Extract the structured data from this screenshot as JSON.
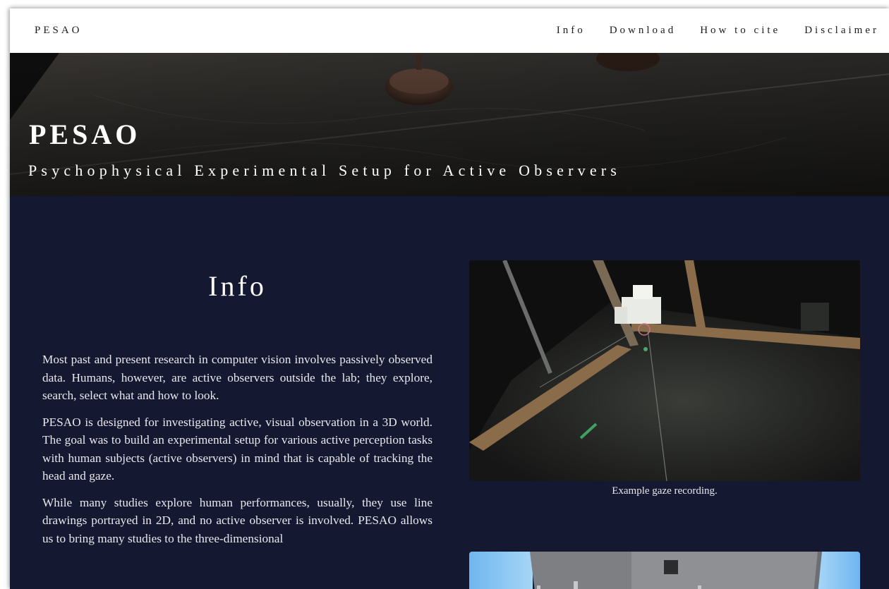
{
  "nav": {
    "brand": "PESAO",
    "links": [
      "Info",
      "Download",
      "How to cite",
      "Disclaimer"
    ]
  },
  "hero": {
    "title": "PESAO",
    "subtitle": "Psychophysical Experimental Setup for Active Observers"
  },
  "info": {
    "heading": "Info",
    "paragraphs": [
      "Most past and present research in computer vision involves passively observed data. Humans, however, are active observers outside the lab; they explore, search, select what and how to look.",
      "PESAO is designed for investigating active, visual observation in a 3D world. The goal was to build an experimental setup for various active perception tasks with human subjects (active observers) in mind that is capable of tracking the head and gaze.",
      "While many studies explore human performances, usually, they use line drawings portrayed in 2D, and no active observer is involved. PESAO allows us to bring many studies to the three-dimensional"
    ]
  },
  "figures": {
    "gaze_caption": "Example gaze recording."
  },
  "colors": {
    "background": "#141830",
    "nav_background": "#ffffff",
    "text": "#e8e8ee"
  }
}
